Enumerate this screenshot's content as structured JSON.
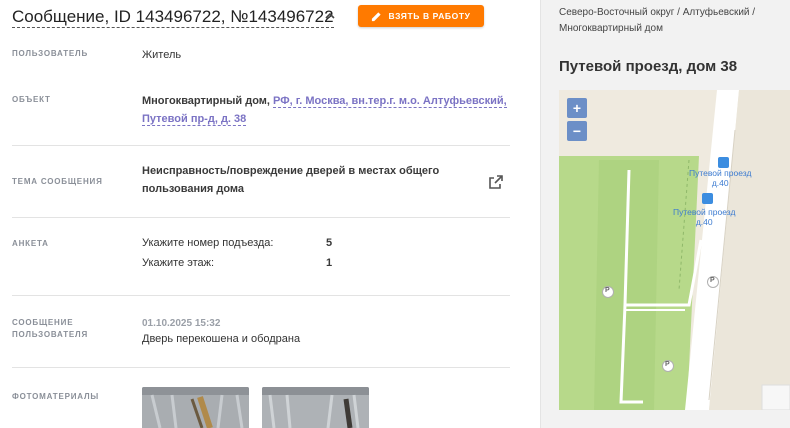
{
  "header": {
    "title": "Сообщение, ID 143496722, №143496722",
    "take_button": "ВЗЯТЬ В РАБОТУ"
  },
  "fields": {
    "user_label": "ПОЛЬЗОВАТЕЛЬ",
    "user_value": "Житель",
    "object_label": "ОБЪЕКТ",
    "object_type": "Многоквартирный дом,",
    "object_link_line1": "РФ, г. Москва, вн.тер.г. м.о. Алтуфьевский,",
    "object_link_line2": "Путевой пр-д, д. 38",
    "topic_label": "ТЕМА СООБЩЕНИЯ",
    "topic_line1": "Неисправность/повреждение дверей в местах общего",
    "topic_line2": "пользования дома",
    "survey_label": "АНКЕТА",
    "survey": [
      {
        "question": "Укажите номер подъезда:",
        "answer": "5"
      },
      {
        "question": "Укажите этаж:",
        "answer": "1"
      }
    ],
    "message_label_line1": "СООБЩЕНИЕ",
    "message_label_line2": "ПОЛЬЗОВАТЕЛЯ",
    "message_date": "01.10.2025 15:32",
    "message_text": "Дверь перекошена и ободрана",
    "photos_label": "ФОТОМАТЕРИАЛЫ"
  },
  "sidebar": {
    "breadcrumb_line1": "Северо-Восточный округ / Алтуфьевский /",
    "breadcrumb_line2": "Многоквартирный дом",
    "address": "Путевой проезд, дом 38",
    "map": {
      "zoom_in": "+",
      "zoom_out": "−",
      "stop_labels": [
        {
          "line1": "Путевой проезд",
          "line2": "д.40"
        },
        {
          "line1": "Путевой проезд",
          "line2": "д.40"
        }
      ],
      "parking_glyph": "P"
    }
  },
  "colors": {
    "accent_orange": "#ff7a00",
    "link_purple": "#7b73c4",
    "map_green": "#b7d98a"
  }
}
